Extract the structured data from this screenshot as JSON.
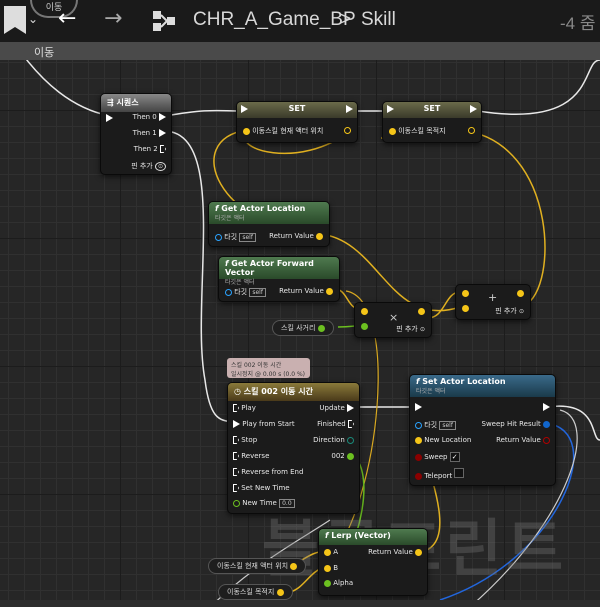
{
  "toolbar": {
    "breadcrumb_blueprint": "CHR_A_Game_BP",
    "breadcrumb_separator": ">",
    "breadcrumb_graph": "Skill",
    "zoom_label": "-4 줌",
    "top_circle_label": "이동",
    "tab_label": "이동"
  },
  "nodes": {
    "sequence": {
      "title": "시퀀스",
      "then0": "Then 0",
      "then1": "Then 1",
      "then2": "Then 2",
      "add_pin": "핀 추가"
    },
    "set1": {
      "title": "SET",
      "pin": "이동스킬 현재 액터 위치"
    },
    "set2": {
      "title": "SET",
      "pin": "이동스킬 목적지"
    },
    "get_location": {
      "title": "Get Actor Location",
      "subtitle": "타깃은 액터",
      "target": "타깃",
      "self": "self",
      "ret": "Return Value"
    },
    "get_forward": {
      "title": "Get Actor Forward Vector",
      "subtitle": "타깃은 액터",
      "target": "타깃",
      "self": "self",
      "ret": "Return Value"
    },
    "multiply": {
      "symbol": "×",
      "add_pin": "핀 추가"
    },
    "add": {
      "symbol": "+",
      "add_pin": "핀 추가"
    },
    "distance_var": "스킬 사거리",
    "timeline_tooltip": {
      "line1": "스킬 002 이동 시간",
      "line2": "일시정지 @ 0.00 s (0.0 %)"
    },
    "timeline": {
      "title": "스킬 002 이동 시간",
      "inputs": [
        "Play",
        "Play from Start",
        "Stop",
        "Reverse",
        "Reverse from End",
        "Set New Time",
        "New Time"
      ],
      "new_time_value": "0.0",
      "outputs": [
        "Update",
        "Finished",
        "Direction",
        "002"
      ]
    },
    "set_location": {
      "title": "Set Actor Location",
      "subtitle": "타깃은 액터",
      "target": "타깃",
      "self": "self",
      "new_location": "New Location",
      "sweep": "Sweep",
      "teleport": "Teleport",
      "sweep_hit": "Sweep Hit Result",
      "ret": "Return Value"
    },
    "lerp": {
      "title": "Lerp (Vector)",
      "a": "A",
      "b": "B",
      "alpha": "Alpha",
      "ret": "Return Value"
    },
    "var_current": "이동스킬 현재 액터 위치",
    "var_dest": "이동스킬 목적지"
  },
  "watermark": "블루프린트",
  "colors": {
    "exec": "#ffffff",
    "vector": "#f5c518",
    "float": "#7ed321",
    "object": "#2aa3ff",
    "bool": "#b00000",
    "struct": "#1166cc"
  }
}
